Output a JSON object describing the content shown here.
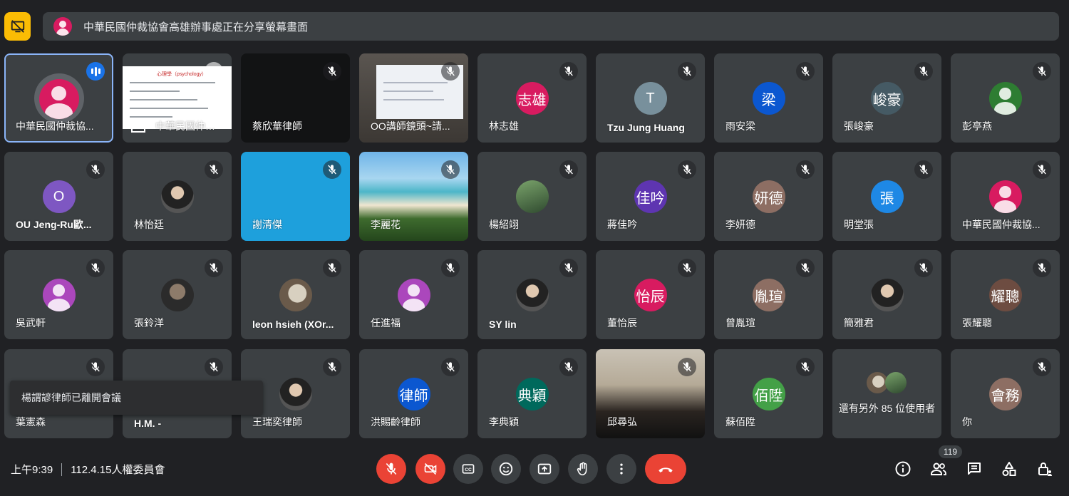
{
  "banner": {
    "text": "中華民國仲裁協會高雄辦事處正在分享螢幕畫面"
  },
  "slide": {
    "title": "心理學（psychology）"
  },
  "tiles": [
    {
      "name": "中華民國仲裁協..."
    },
    {
      "name": "中華民國仲…"
    },
    {
      "name": "蔡欣華律師"
    },
    {
      "name": "OO講師鏡頭~請..."
    },
    {
      "name": "林志雄",
      "initials": "志雄",
      "color": "#d81b60"
    },
    {
      "name": "Tzu Jung Huang",
      "initials": "T",
      "color": "#78909c"
    },
    {
      "name": "雨安梁",
      "initials": "梁",
      "color": "#0b57d0"
    },
    {
      "name": "張峻豪",
      "initials": "峻豪",
      "color": "#455a64"
    },
    {
      "name": "彭亭燕"
    },
    {
      "name": "OU Jeng-Ru歐...",
      "initials": "O",
      "color": "#7e57c2"
    },
    {
      "name": "林怡廷"
    },
    {
      "name": "謝清傑"
    },
    {
      "name": "李麗花"
    },
    {
      "name": "楊紹翊"
    },
    {
      "name": "蔣佳吟",
      "initials": "佳吟",
      "color": "#5e35b1"
    },
    {
      "name": "李妍德",
      "initials": "妍德",
      "color": "#8d6e63"
    },
    {
      "name": "明堂張",
      "initials": "張",
      "color": "#1e88e5"
    },
    {
      "name": "中華民國仲裁協..."
    },
    {
      "name": "吳武軒"
    },
    {
      "name": "張鈴洋"
    },
    {
      "name": "leon hsieh (XOr..."
    },
    {
      "name": "任進福"
    },
    {
      "name": "SY lin"
    },
    {
      "name": "董怡辰",
      "initials": "怡辰",
      "color": "#d81b60"
    },
    {
      "name": "曾胤瑄",
      "initials": "胤瑄",
      "color": "#8d6e63"
    },
    {
      "name": "簡雅君"
    },
    {
      "name": "張耀聰",
      "initials": "耀聰",
      "color": "#6d4c41"
    },
    {
      "name": "葉憲森"
    },
    {
      "name": "H.M. -"
    },
    {
      "name": "王瑞奕律師"
    },
    {
      "name": "洪賜齡律師",
      "initials": "律師",
      "color": "#0b57d0"
    },
    {
      "name": "李典穎",
      "initials": "典穎",
      "color": "#00695c"
    },
    {
      "name": "邱尋弘"
    },
    {
      "name": "蘇佰陞",
      "initials": "佰陞",
      "color": "#43a047"
    },
    {
      "name": "還有另外 85 位使用者"
    },
    {
      "name": "你",
      "initials": "會務",
      "color": "#8d6e63"
    }
  ],
  "toast": {
    "text": "楊謂諺律師已離開會議"
  },
  "meeting": {
    "time": "上午9:39",
    "title": "112.4.15人權委員會"
  },
  "participants_count": "119",
  "colors": {
    "accent": "#8ab4f8",
    "danger": "#ea4335",
    "present": "#fbbc04"
  }
}
